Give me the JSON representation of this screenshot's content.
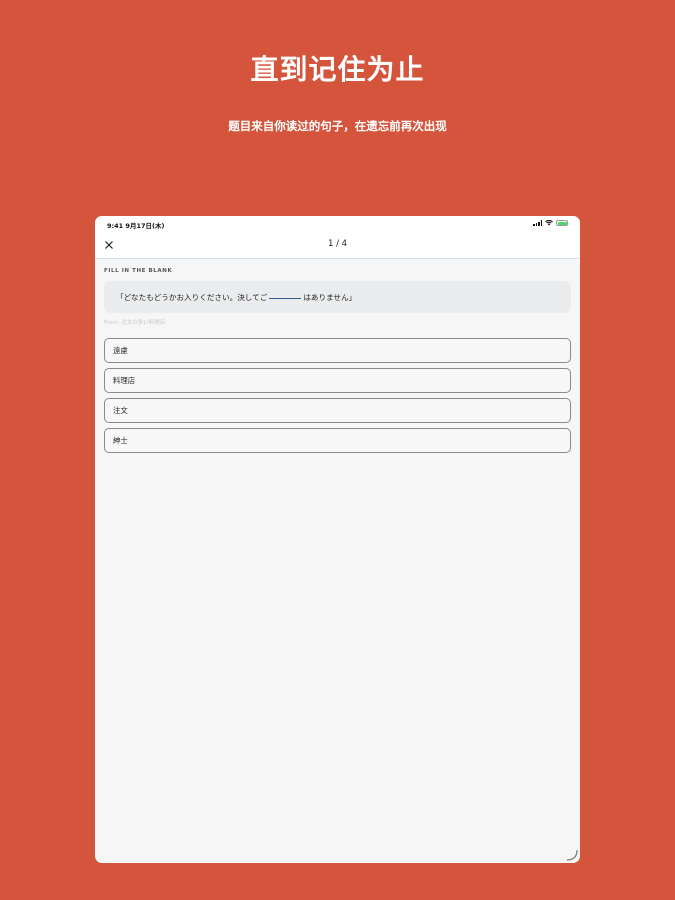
{
  "poster": {
    "title": "直到记住为止",
    "subtitle": "题目来自你读过的句子，在遗忘前再次出现"
  },
  "status_bar": {
    "time": "9:41  9月17日(木)",
    "battery_color": "#4cd964"
  },
  "nav": {
    "close_icon": "close-icon",
    "progress": "1 / 4"
  },
  "quiz": {
    "section_label": "FILL IN THE BLANK",
    "sentence_before": "「どなたもどうかお入りください。決してご",
    "sentence_after": "はありません」",
    "source": "From: 注文の多い料理店",
    "options": [
      {
        "label": "遠慮"
      },
      {
        "label": "料理店"
      },
      {
        "label": "注文"
      },
      {
        "label": "紳士"
      }
    ]
  },
  "colors": {
    "background": "#d4553c",
    "card": "#ebeced",
    "accent_blank": "#2c5a8a"
  }
}
